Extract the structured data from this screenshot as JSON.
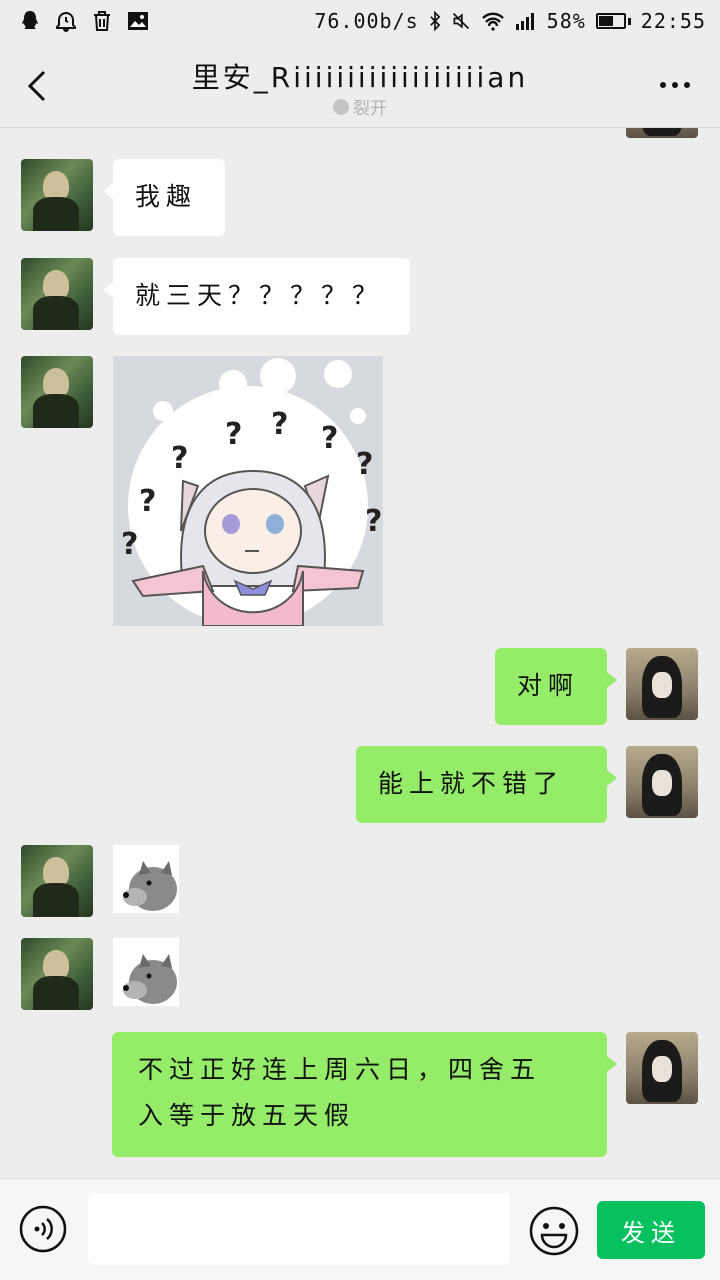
{
  "status_bar": {
    "network_speed": "76.00b/s",
    "battery_percent": "58%",
    "battery_level": 0.58,
    "time": "22:55",
    "left_icons": [
      "qq-icon",
      "alarm-icon",
      "trash-icon",
      "image-icon"
    ],
    "right_icons": [
      "bluetooth-icon",
      "mute-icon",
      "wifi-icon",
      "signal-icon",
      "battery-icon"
    ]
  },
  "header": {
    "title": "里安_Riiiiiiiiiiiiiiiiiian",
    "subtitle": "裂开"
  },
  "messages": [
    {
      "side": "in",
      "type": "text",
      "text": "我趣"
    },
    {
      "side": "in",
      "type": "text",
      "text": "就三天？？？？？"
    },
    {
      "side": "in",
      "type": "sticker",
      "sticker": "confused-anime-girl-sticker"
    },
    {
      "side": "out",
      "type": "text",
      "text": "对啊"
    },
    {
      "side": "out",
      "type": "text",
      "text": "能上就不错了"
    },
    {
      "side": "in",
      "type": "sticker",
      "sticker": "doge-sticker"
    },
    {
      "side": "in",
      "type": "sticker",
      "sticker": "doge-sticker"
    },
    {
      "side": "out",
      "type": "text",
      "text_lines": [
        "不过正好连上周六日，四舍五",
        "入等于放五天假"
      ]
    }
  ],
  "input_bar": {
    "input_value": "",
    "send_label": "发送"
  },
  "colors": {
    "background": "#ededed",
    "outgoing_bubble": "#95ec69",
    "incoming_bubble": "#ffffff",
    "send_button": "#07c160"
  }
}
